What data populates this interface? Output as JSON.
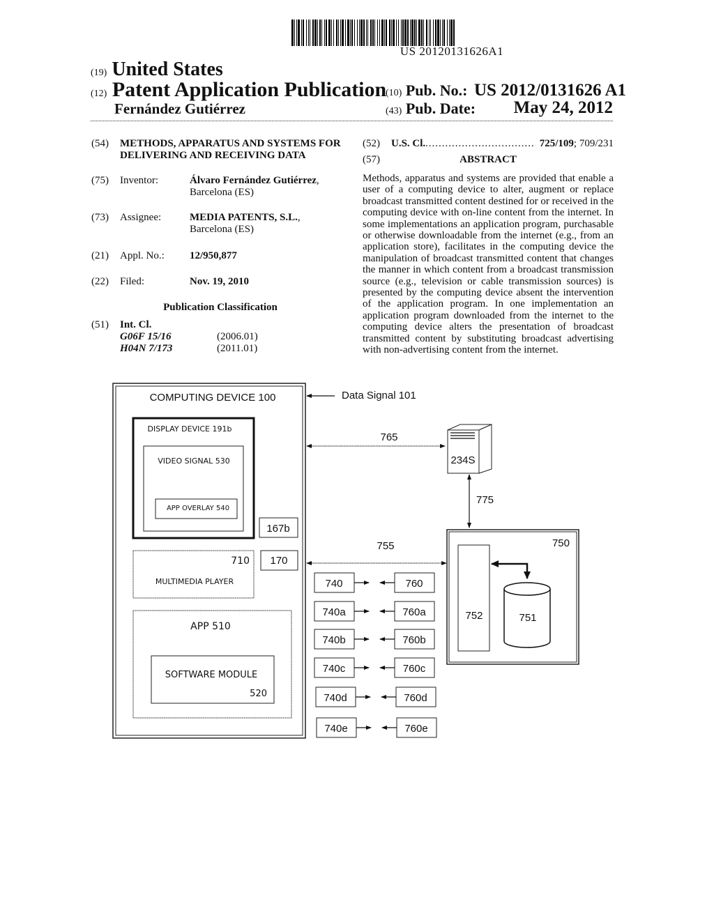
{
  "header": {
    "barcode_text": "US 20120131626A1",
    "country_code": "(19)",
    "country": "United States",
    "pubtype_code": "(12)",
    "pubtype": "Patent Application Publication",
    "inventor_surname": "Fernández Gutiérrez",
    "pub_no_code": "(10)",
    "pub_no_label": "Pub. No.:",
    "pub_no": "US 2012/0131626 A1",
    "pub_date_code": "(43)",
    "pub_date_label": "Pub. Date:",
    "pub_date": "May 24, 2012"
  },
  "biblio": {
    "title": {
      "code": "(54)",
      "text": "METHODS, APPARATUS AND SYSTEMS FOR DELIVERING AND RECEIVING DATA"
    },
    "inventor": {
      "code": "(75)",
      "label": "Inventor:",
      "name": "Álvaro Fernández Gutiérrez",
      "location": "Barcelona (ES)"
    },
    "assignee": {
      "code": "(73)",
      "label": "Assignee:",
      "name": "MEDIA PATENTS, S.L.",
      "location": "Barcelona (ES)"
    },
    "appl_no": {
      "code": "(21)",
      "label": "Appl. No.:",
      "value": "12/950,877"
    },
    "filed": {
      "code": "(22)",
      "label": "Filed:",
      "value": "Nov. 19, 2010"
    },
    "pub_classification_heading": "Publication Classification",
    "int_cl": {
      "code": "(51)",
      "label": "Int. Cl.",
      "entries": [
        {
          "class": "G06F 15/16",
          "version": "(2006.01)"
        },
        {
          "class": "H04N 7/173",
          "version": "(2011.01)"
        }
      ]
    },
    "us_cl": {
      "code": "(52)",
      "label": "U.S. Cl.",
      "dots": "..........................................",
      "primary": "725/109",
      "secondary": "; 709/231"
    },
    "abstract": {
      "code": "(57)",
      "heading": "ABSTRACT",
      "text": "Methods, apparatus and systems are provided that enable a user of a computing device to alter, augment or replace broad­cast transmitted content destined for or received in the com­puting device with on-line content from the internet. In some implementations an application program, purchasable or oth­erwise downloadable from the internet (e.g., from an appli­cation store), facilitates in the computing device the manipu­lation of broadcast transmitted content that changes the manner in which content from a broadcast transmission source (e.g., television or cable transmission sources) is pre­sented by the computing device absent the intervention of the application program. In one implementation an application program downloaded from the internet to the computing device alters the presentation of broadcast transmitted con­tent by substituting broadcast advertising with non-advertis­ing content from the internet."
    }
  },
  "figure": {
    "computing_device": "COMPUTING DEVICE  100",
    "display_device": "DISPLAY DEVICE  191b",
    "video_signal": "VIDEO SIGNAL 530",
    "app_overlay": "APP OVERLAY 540",
    "box_167b": "167b",
    "multimedia_player_num": "710",
    "multimedia_player": "MULTIMEDIA PLAYER",
    "box_170": "170",
    "app": "APP 510",
    "software_module": "SOFTWARE MODULE",
    "software_module_num": "520",
    "data_signal": "Data Signal 101",
    "link_765": "765",
    "server": "234S",
    "link_775": "775",
    "link_755": "755",
    "system_750": "750",
    "box_752": "752",
    "db_751": "751",
    "left_boxes": [
      "740",
      "740a",
      "740b",
      "740c",
      "740d",
      "740e"
    ],
    "right_boxes": [
      "760",
      "760a",
      "760b",
      "760c",
      "760d",
      "760e"
    ]
  }
}
